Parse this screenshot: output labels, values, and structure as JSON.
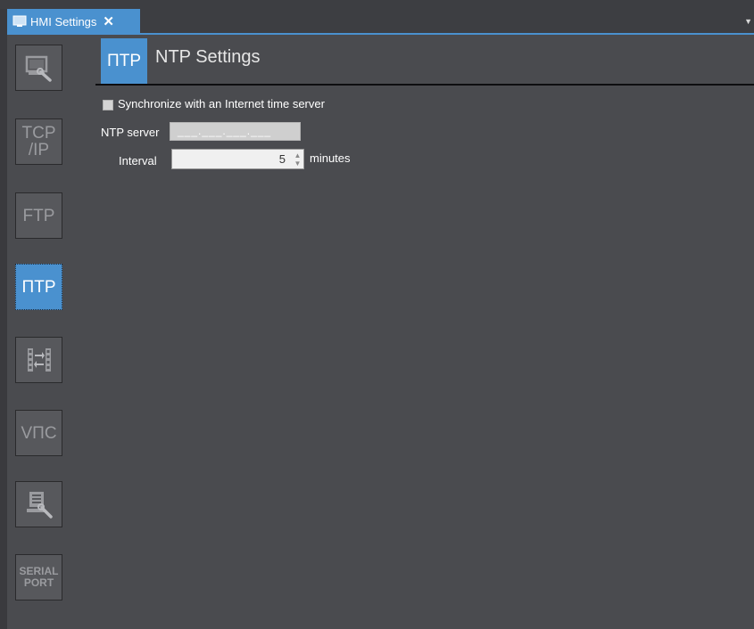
{
  "tab": {
    "label": "HMI Settings",
    "close": "✕",
    "icon": "monitor-icon",
    "dropdown": "▼"
  },
  "sidebar": {
    "items": [
      {
        "name": "hmi-device",
        "icon": "monitor-wrench-icon",
        "text": ""
      },
      {
        "name": "tcp-ip",
        "icon": "tcp-ip-icon",
        "text_line1": "TCP",
        "text_line2": "/IP"
      },
      {
        "name": "ftp",
        "icon": "ftp-icon",
        "text": "FTP"
      },
      {
        "name": "ntp",
        "icon": "ntp-icon",
        "text": "ΠTP",
        "active": true
      },
      {
        "name": "transfer",
        "icon": "transfer-arrows-icon",
        "text": ""
      },
      {
        "name": "vnc",
        "icon": "vnc-icon",
        "text": "VΠC"
      },
      {
        "name": "remote-maintenance",
        "icon": "computer-wrench-icon",
        "text": ""
      },
      {
        "name": "serial-port",
        "icon": "serial-port-icon",
        "text_line1": "SERIAL",
        "text_line2": "PORT"
      }
    ]
  },
  "header": {
    "icon_text": "ΠTP",
    "title": "NTP Settings"
  },
  "form": {
    "sync_label": "Synchronize with an Internet time server",
    "sync_checked": false,
    "ntp_server_label": "NTP server",
    "ntp_server_value": "___.___.___.___",
    "interval_label": "Interval",
    "interval_value": "5",
    "interval_unit": "minutes"
  },
  "colors": {
    "accent": "#4a91cf",
    "background": "#4a4b4f",
    "sidebar_button": "#57585c"
  }
}
